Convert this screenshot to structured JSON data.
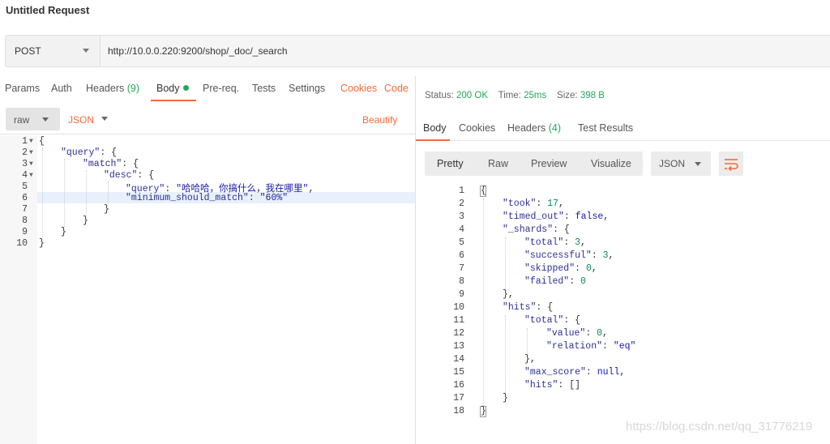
{
  "window": {
    "title": "Untitled Request"
  },
  "request": {
    "method": "POST",
    "url": "http://10.0.0.220:9200/shop/_doc/_search",
    "tabs": [
      {
        "label": "Params"
      },
      {
        "label": "Auth"
      },
      {
        "label": "Headers",
        "count": "(9)"
      },
      {
        "label": "Body"
      },
      {
        "label": "Pre-req."
      },
      {
        "label": "Tests"
      },
      {
        "label": "Settings"
      }
    ],
    "cookies_link": "Cookies",
    "code_link": "Code",
    "body_mode": "raw",
    "body_type": "JSON",
    "beautify": "Beautify",
    "line_numbers": [
      "1",
      "2",
      "3",
      "4",
      "5",
      "6",
      "7",
      "8",
      "9",
      "10"
    ],
    "code": {
      "l1": "{",
      "l2_key": "\"query\"",
      "l2_rest": ": {",
      "l3_key": "\"match\"",
      "l3_rest": ": {",
      "l4_key": "\"desc\"",
      "l4_rest": ": {",
      "l5_key": "\"query\"",
      "l5_sep": ": ",
      "l5_val": "\"哈哈哈，你搞什么，我在哪里\"",
      "l5_end": ",",
      "l6_key": "\"minimum_should_match\"",
      "l6_sep": ": ",
      "l6_val": "\"60%\"",
      "l7": "}",
      "l8": "}",
      "l9": "}",
      "l10": "}"
    }
  },
  "response": {
    "status_label": "Status:",
    "status_value": "200 OK",
    "time_label": "Time:",
    "time_value": "25ms",
    "size_label": "Size:",
    "size_value": "398 B",
    "tabs": [
      {
        "label": "Body"
      },
      {
        "label": "Cookies"
      },
      {
        "label": "Headers",
        "count": "(4)"
      },
      {
        "label": "Test Results"
      }
    ],
    "view_modes": [
      "Pretty",
      "Raw",
      "Preview",
      "Visualize"
    ],
    "format": "JSON",
    "line_numbers": [
      "1",
      "2",
      "3",
      "4",
      "5",
      "6",
      "7",
      "8",
      "9",
      "10",
      "11",
      "12",
      "13",
      "14",
      "15",
      "16",
      "17",
      "18"
    ],
    "code": {
      "l1": "{",
      "l2_key": "\"took\"",
      "l2_val": "17",
      "l3_key": "\"timed_out\"",
      "l3_val": "false",
      "l4_key": "\"_shards\"",
      "l4_rest": ": {",
      "l5_key": "\"total\"",
      "l5_val": "3",
      "l6_key": "\"successful\"",
      "l6_val": "3",
      "l7_key": "\"skipped\"",
      "l7_val": "0",
      "l8_key": "\"failed\"",
      "l8_val": "0",
      "l9": "},",
      "l10_key": "\"hits\"",
      "l10_rest": ": {",
      "l11_key": "\"total\"",
      "l11_rest": ": {",
      "l12_key": "\"value\"",
      "l12_val": "0",
      "l13_key": "\"relation\"",
      "l13_val": "\"eq\"",
      "l14": "},",
      "l15_key": "\"max_score\"",
      "l15_val": "null",
      "l16_key": "\"hits\"",
      "l16_val": "[]",
      "l17": "}",
      "l18": "}"
    }
  },
  "watermark": "https://blog.csdn.net/qq_31776219",
  "colors": {
    "accent": "#f26b3a",
    "success": "#26a65b"
  }
}
